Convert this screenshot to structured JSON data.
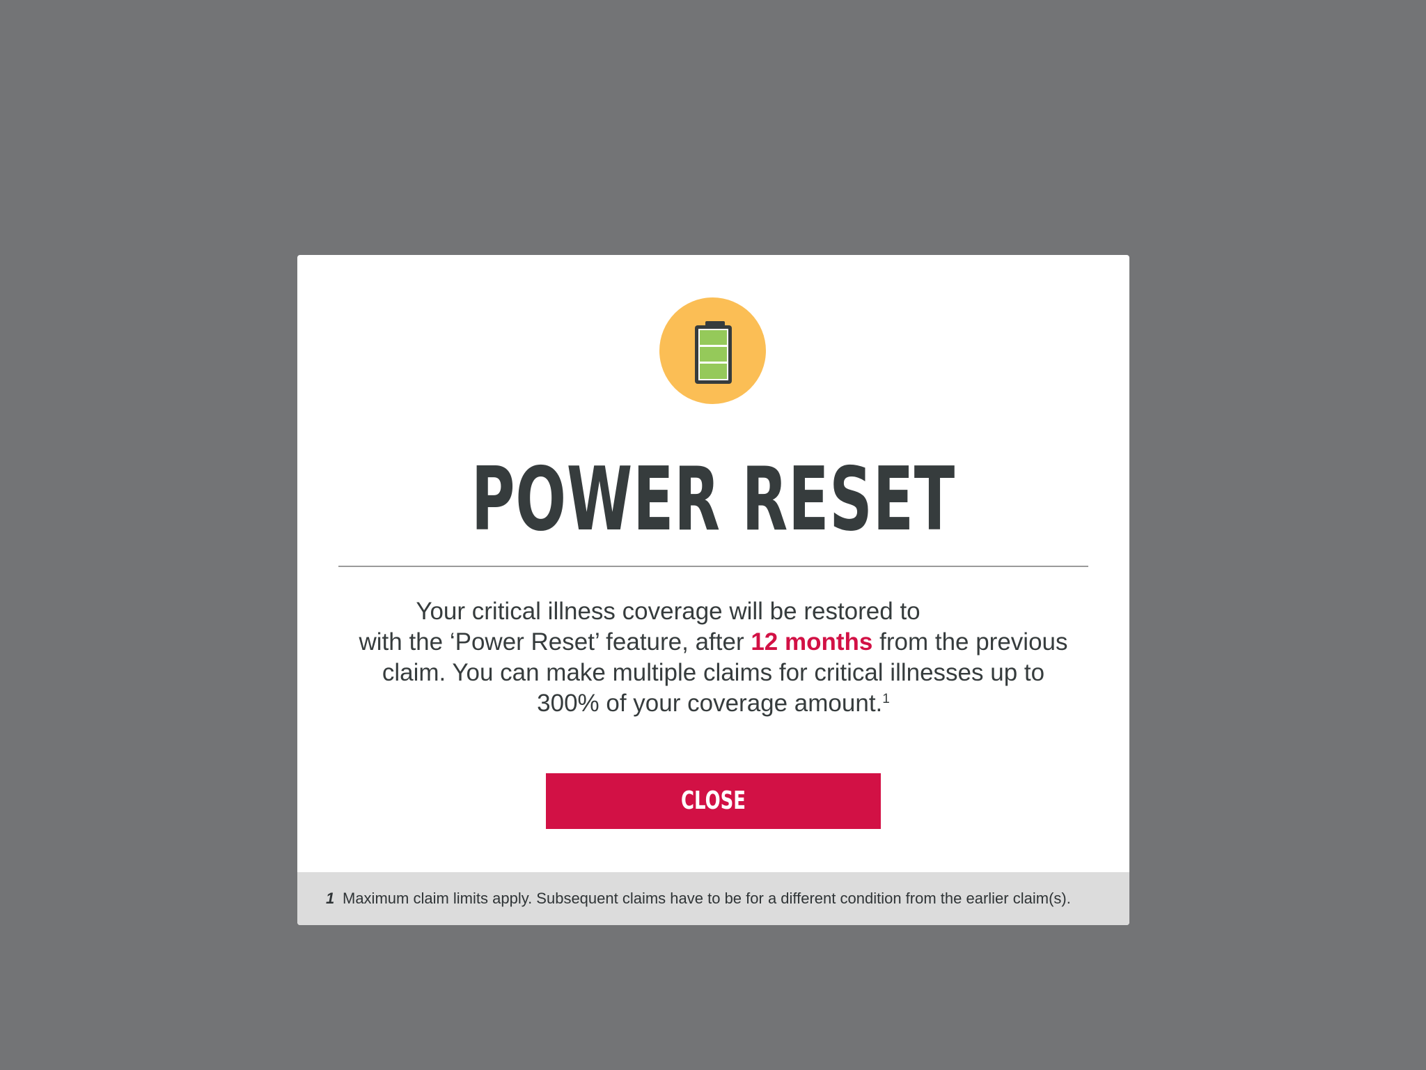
{
  "modal": {
    "icon": "battery-full-icon",
    "title": "POWER RESET",
    "body": {
      "line1": "Your critical illness coverage will be restored to",
      "line2_pre": "with the ‘Power Reset’ feature, after ",
      "line2_highlight": "12 months",
      "line2_post": " from the previous",
      "line3": "claim. You can make multiple claims for critical illnesses up to",
      "line4": "300% of your coverage amount.",
      "footnote_ref": "1"
    },
    "close_label": "CLOSE",
    "footnote": {
      "number": "1",
      "text": "Maximum claim limits apply. Subsequent claims have to be for a different condition from the earlier claim(s)."
    }
  },
  "colors": {
    "backdrop": "#737476",
    "accent": "#d21145",
    "icon_circle": "#fbbe55",
    "battery_fill": "#95c95a",
    "title": "#363c3d"
  }
}
